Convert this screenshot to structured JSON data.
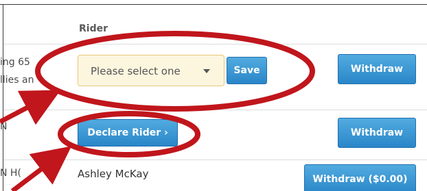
{
  "table": {
    "rider_header": "Rider",
    "rows": [
      {
        "left_text_1": "ing 65",
        "left_text_2": "llies an",
        "select_placeholder": "Please select one",
        "save_label": "Save",
        "withdraw_label": "Withdraw"
      },
      {
        "left_text": "N",
        "declare_label": "Declare Rider ›",
        "withdraw_label": "Withdraw"
      },
      {
        "left_text": "N H(",
        "rider_name": "Ashley McKay",
        "withdraw_label": "Withdraw ($0.00)"
      }
    ]
  },
  "annotations": {
    "color": "#c0161c",
    "shapes": [
      "ellipse",
      "ellipse",
      "arrow",
      "arrow"
    ]
  },
  "colors": {
    "button": "#2a86c8",
    "select_bg": "#fcf6df",
    "select_border": "#e8c879"
  },
  "icons": [
    "chevron-down-icon"
  ]
}
